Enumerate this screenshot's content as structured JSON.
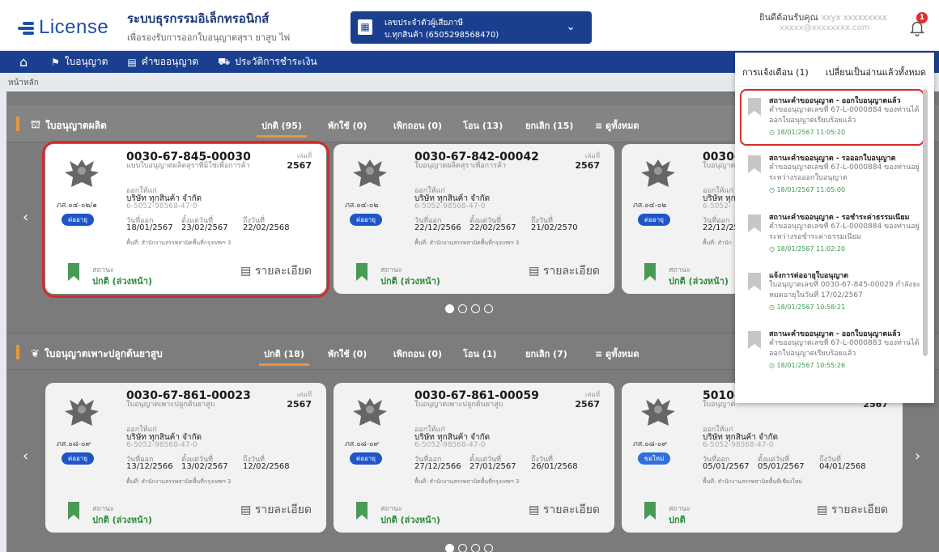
{
  "header": {
    "logo_text": "License",
    "system_title": "ระบบธุรกรรมอิเล็กทรอนิกส์",
    "system_subtitle": "เพื่อรองรับการออกใบอนุญาตสุรา ยาสูบ ไพ่",
    "tax_label": "เลขประจำตัวผู้เสียภาษี",
    "tax_value": "บ.ทุกสินค้า (6505298568470)",
    "welcome_label": "ยินดีต้อนรับคุณ",
    "welcome_name": "xxyx xxxxxxxxx",
    "email": "xxxxx@xxxxxxxx.com",
    "notification_count": "1"
  },
  "nav": {
    "items": [
      {
        "label": "ใบอนุญาต"
      },
      {
        "label": "คำขออนุญาต"
      },
      {
        "label": "ประวัติการชำระเงิน"
      }
    ]
  },
  "breadcrumb": "หน้าหลัก",
  "sections": [
    {
      "title": "ใบอนุญาตผลิต",
      "tabs": [
        "ปกติ (95)",
        "พักใช้ (0)",
        "เพิกถอน (0)",
        "โอน (13)",
        "ยกเลิก (15)",
        "≡ ดูทั้งหมด"
      ],
      "cards": [
        {
          "no": "0030-67-845-00030",
          "sub": "แบบใบอนุญาตผลิตสุราที่มิใช่เพื่อการค้า",
          "year_label": "เล่มที่",
          "year": "2567",
          "code": "ภส.๐๔-๐๒/๑",
          "button": "ต่ออายุ",
          "issue_label": "ออกให้แก่",
          "issuer": "บริษัท ทุกสินค้า จำกัด",
          "id": "6-5052-98568-47-0",
          "d1_label": "วันที่ออก",
          "d1": "18/01/2567",
          "d2_label": "ตั้งแต่วันที่",
          "d2": "23/02/2567",
          "d3_label": "ถึงวันที่",
          "d3": "22/02/2568",
          "place": "พื้นที่: สำนักงานสรรพสามิตพื้นที่กรุงเทพฯ 3",
          "status_label": "สถานะ",
          "status": "ปกติ (ล่วงหน้า)",
          "detail": "รายละเอียด"
        },
        {
          "no": "0030-67-842-00042",
          "sub": "ใบอนุญาตผลิตสุราเพื่อการค้า",
          "year_label": "เล่มที่",
          "year": "2567",
          "code": "ภส.๐๔-๐๒",
          "button": "ต่ออายุ",
          "issue_label": "ออกให้แก่",
          "issuer": "บริษัท ทุกสินค้า จำกัด",
          "id": "6-5052-98568-47-0",
          "d1_label": "วันที่ออก",
          "d1": "22/12/2566",
          "d2_label": "ตั้งแต่วันที่",
          "d2": "22/02/2567",
          "d3_label": "ถึงวันที่",
          "d3": "21/02/2570",
          "place": "พื้นที่: สำนักงานสรรพสามิตพื้นที่กรุงเทพฯ 3",
          "status_label": "สถานะ",
          "status": "ปกติ (ล่วงหน้า)",
          "detail": "รายละเอียด"
        },
        {
          "no": "0030-6",
          "sub": "ใบอนุญาต",
          "year_label": "",
          "year": "",
          "code": "ภส.๐๔-๐๒",
          "button": "ต่ออายุ",
          "issue_label": "ออกให้แก่",
          "issuer": "บริษัท ทุกส",
          "id": "6-5052-",
          "d1_label": "วันที่ออก",
          "d1": "22/12/256",
          "d2_label": "",
          "d2": "",
          "d3_label": "",
          "d3": "",
          "place": "พื้นที่: สำนัก",
          "status_label": "สถานะ",
          "status": "ปกติ (ล่วงหน้า)",
          "detail": ""
        }
      ],
      "dots": 4
    },
    {
      "title": "ใบอนุญาตเพาะปลูกต้นยาสูบ",
      "tabs": [
        "ปกติ (18)",
        "พักใช้ (0)",
        "เพิกถอน (0)",
        "โอน (1)",
        "ยกเลิก (7)",
        "≡ ดูทั้งหมด"
      ],
      "cards": [
        {
          "no": "0030-67-861-00023",
          "sub": "ใบอนุญาตเพาะปลูกต้นยาสูบ",
          "year_label": "เล่มที่",
          "year": "2567",
          "code": "ภส.๐๘-๐๙",
          "button": "ต่ออายุ",
          "issue_label": "ออกให้แก่",
          "issuer": "บริษัท ทุกสินค้า จำกัด",
          "id": "6-5052-98568-47-0",
          "d1_label": "วันที่ออก",
          "d1": "13/12/2566",
          "d2_label": "ตั้งแต่วันที่",
          "d2": "13/02/2567",
          "d3_label": "ถึงวันที่",
          "d3": "12/02/2568",
          "place": "พื้นที่: สำนักงานสรรพสามิตพื้นที่กรุงเทพฯ 3",
          "status_label": "สถานะ",
          "status": "ปกติ (ล่วงหน้า)",
          "detail": "รายละเอียด"
        },
        {
          "no": "0030-67-861-00059",
          "sub": "ใบอนุญาตเพาะปลูกต้นยาสูบ",
          "year_label": "เล่มที่",
          "year": "2567",
          "code": "ภส.๐๘-๐๙",
          "button": "ต่ออายุ",
          "issue_label": "ออกให้แก่",
          "issuer": "บริษัท ทุกสินค้า จำกัด",
          "id": "6-5052-98568-47-0",
          "d1_label": "วันที่ออก",
          "d1": "27/12/2566",
          "d2_label": "ตั้งแต่วันที่",
          "d2": "27/01/2567",
          "d3_label": "ถึงวันที่",
          "d3": "26/01/2568",
          "place": "พื้นที่: สำนักงานสรรพสามิตพื้นที่กรุงเทพฯ 3",
          "status_label": "สถานะ",
          "status": "ปกติ (ล่วงหน้า)",
          "detail": "รายละเอียด"
        },
        {
          "no": "5010-6",
          "sub": "ใบอนุญาต",
          "year_label": "",
          "year": "2567",
          "code": "ภส.๐๘-๐๙",
          "button": "ขอใหม่",
          "issue_label": "ออกให้แก่",
          "issuer": "บริษัท ทุกสินค้า จำกัด",
          "id": "6-5052-98568-47-0",
          "d1_label": "วันที่ออก",
          "d1": "05/01/2567",
          "d2_label": "ตั้งแต่วันที่",
          "d2": "05/01/2567",
          "d3_label": "ถึงวันที่",
          "d3": "04/01/2568",
          "place": "พื้นที่: สำนักงานสรรพสามิตพื้นที่เชียงใหม่",
          "status_label": "สถานะ",
          "status": "ปกติ",
          "detail": "รายละเอียด"
        }
      ],
      "dots": 4
    }
  ],
  "notifications": {
    "title": "การแจ้งเตือน (1)",
    "mark_all": "เปลี่ยนเป็นอ่านแล้วทั้งหมด",
    "items": [
      {
        "title": "สถานะคำขออนุญาต - ออกใบอนุญาตแล้ว",
        "body": "คำขออนุญาตเลขที่ 67-L-0000884 ของท่านได้ออกใบอนุญาตเรียบร้อยแล้ว",
        "time": "18/01/2567 11:05:20",
        "unread": true
      },
      {
        "title": "สถานะคำขออนุญาต - รอออกใบอนุญาต",
        "body": "คำขออนุญาตเลขที่ 67-L-0000884 ของท่านอยู่ระหว่างรอออกใบอนุญาต",
        "time": "18/01/2567 11:05:00",
        "unread": false
      },
      {
        "title": "สถานะคำขออนุญาต - รอชำระค่าธรรมเนียม",
        "body": "คำขออนุญาตเลขที่ 67-L-0000884 ของท่านอยู่ระหว่างรอชำระค่าธรรมเนียม",
        "time": "18/01/2567 11:02:20",
        "unread": false
      },
      {
        "title": "แจ้งการต่ออายุใบอนุญาต",
        "body": "ใบอนุญาตเลขที่ 0030-67-845-00029 กำลังจะหมดอายุในวันที่ 17/02/2567",
        "time": "18/01/2567 10:58:21",
        "unread": false
      },
      {
        "title": "สถานะคำขออนุญาต - ออกใบอนุญาตแล้ว",
        "body": "คำขออนุญาตเลขที่ 67-L-0000883 ของท่านได้ออกใบอนุญาตเรียบร้อยแล้ว",
        "time": "18/01/2567 10:55:26",
        "unread": false
      }
    ]
  },
  "colors": {
    "primary": "#1b3f8f",
    "accent": "#e8963c",
    "status": "#2c8a3a",
    "alert": "#d72b2b"
  }
}
